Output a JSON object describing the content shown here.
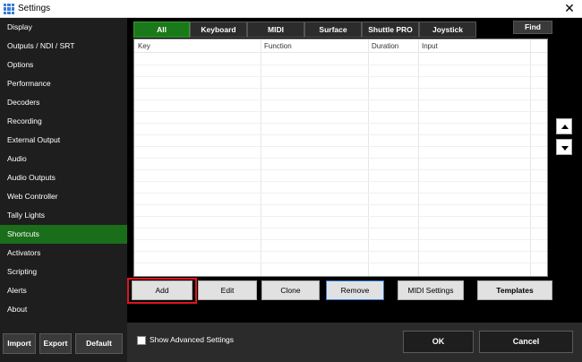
{
  "window": {
    "title": "Settings"
  },
  "sidebar": {
    "items": [
      {
        "label": "Display"
      },
      {
        "label": "Outputs / NDI / SRT"
      },
      {
        "label": "Options"
      },
      {
        "label": "Performance"
      },
      {
        "label": "Decoders"
      },
      {
        "label": "Recording"
      },
      {
        "label": "External Output"
      },
      {
        "label": "Audio"
      },
      {
        "label": "Audio Outputs"
      },
      {
        "label": "Web Controller"
      },
      {
        "label": "Tally Lights"
      },
      {
        "label": "Shortcuts"
      },
      {
        "label": "Activators"
      },
      {
        "label": "Scripting"
      },
      {
        "label": "Alerts"
      },
      {
        "label": "About"
      }
    ],
    "active": "Shortcuts",
    "import_label": "Import",
    "export_label": "Export",
    "default_label": "Default"
  },
  "tabs": [
    {
      "label": "All"
    },
    {
      "label": "Keyboard"
    },
    {
      "label": "MIDI"
    },
    {
      "label": "Surface"
    },
    {
      "label": "Shuttle PRO"
    },
    {
      "label": "Joystick"
    }
  ],
  "active_tab": "All",
  "find_label": "Find",
  "table": {
    "columns": [
      {
        "label": "Key"
      },
      {
        "label": "Function"
      },
      {
        "label": "Duration"
      },
      {
        "label": "Input"
      }
    ]
  },
  "actions": {
    "add": "Add",
    "edit": "Edit",
    "clone": "Clone",
    "remove": "Remove",
    "midi_settings": "MIDI Settings",
    "templates": "Templates"
  },
  "footer": {
    "show_advanced_label": "Show Advanced Settings",
    "show_advanced_checked": false,
    "ok_label": "OK",
    "cancel_label": "Cancel"
  },
  "colors": {
    "accent_green": "#1a7a1a",
    "highlight_red": "#e0141e"
  }
}
